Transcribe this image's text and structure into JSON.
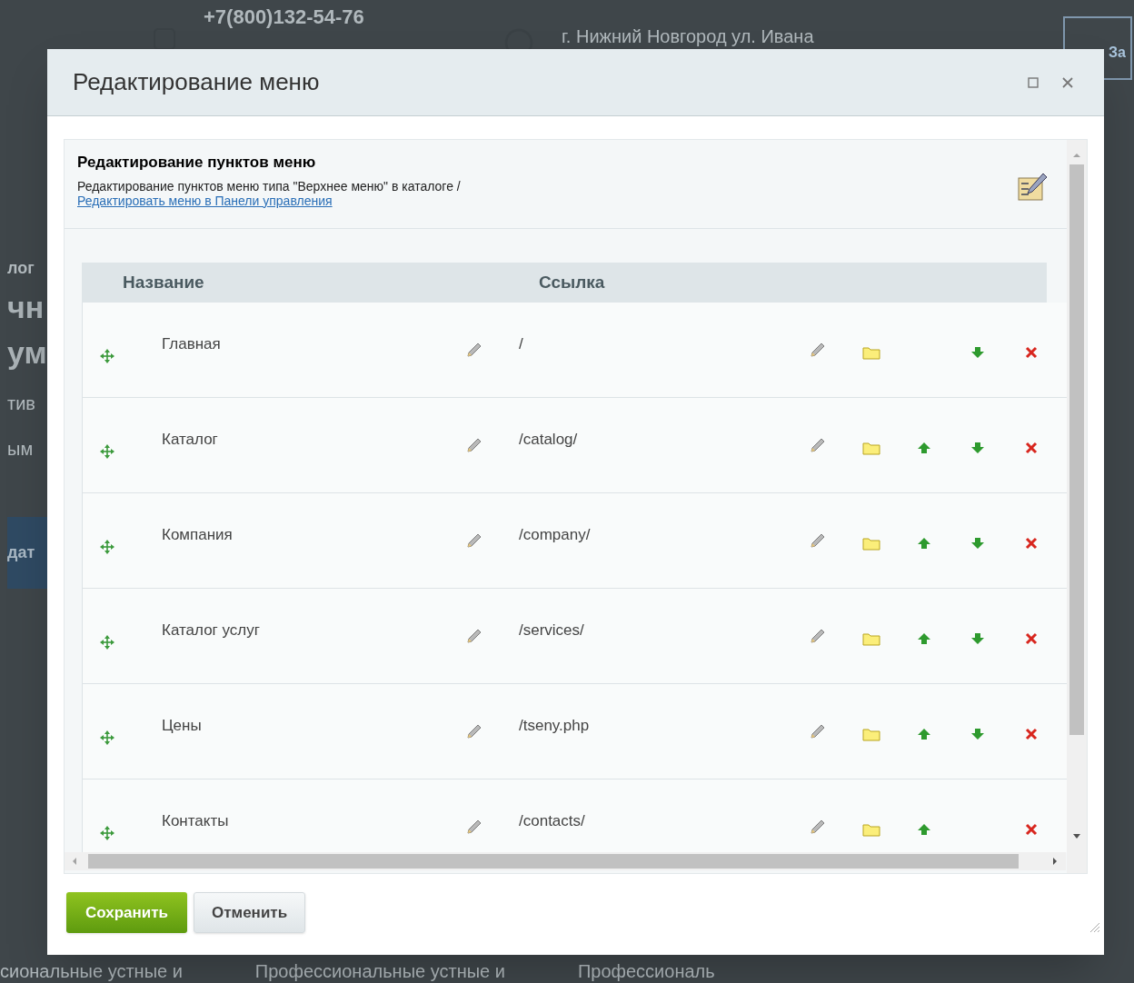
{
  "backdrop": {
    "phone": "+7(800)132-54-76",
    "address": "г. Нижний Новгород ул. Ивана",
    "header_button": "За",
    "left_fragments": [
      {
        "text": "лог",
        "kind": "label"
      },
      {
        "text": "чн",
        "kind": "heading"
      },
      {
        "text": "ум",
        "kind": "heading"
      },
      {
        "text": "тив",
        "kind": "text"
      },
      {
        "text": "ым",
        "kind": "text"
      },
      {
        "text": "дат",
        "kind": "button"
      }
    ],
    "bottom_fragments": [
      "сиональные устные и",
      "Профессиональные устные и",
      "Профессиональ"
    ]
  },
  "dialog": {
    "title": "Редактирование меню",
    "panel_title": "Редактирование пунктов меню",
    "description": "Редактирование пунктов меню типа \"Верхнее меню\" в каталоге /",
    "link": "Редактировать меню в Панели управления",
    "columns": [
      "Название",
      "Ссылка"
    ],
    "rows": [
      {
        "name": "Главная",
        "link": "/",
        "can_move_up": false,
        "can_move_down": true
      },
      {
        "name": "Каталог",
        "link": "/catalog/",
        "can_move_up": true,
        "can_move_down": true
      },
      {
        "name": "Компания",
        "link": "/company/",
        "can_move_up": true,
        "can_move_down": true
      },
      {
        "name": "Каталог услуг",
        "link": "/services/",
        "can_move_up": true,
        "can_move_down": true
      },
      {
        "name": "Цены",
        "link": "/tseny.php",
        "can_move_up": true,
        "can_move_down": true
      },
      {
        "name": "Контакты",
        "link": "/contacts/",
        "can_move_up": true,
        "can_move_down": false
      }
    ],
    "buttons": [
      {
        "label": "Сохранить",
        "kind": "primary"
      },
      {
        "label": "Отменить",
        "kind": "secondary"
      }
    ]
  }
}
